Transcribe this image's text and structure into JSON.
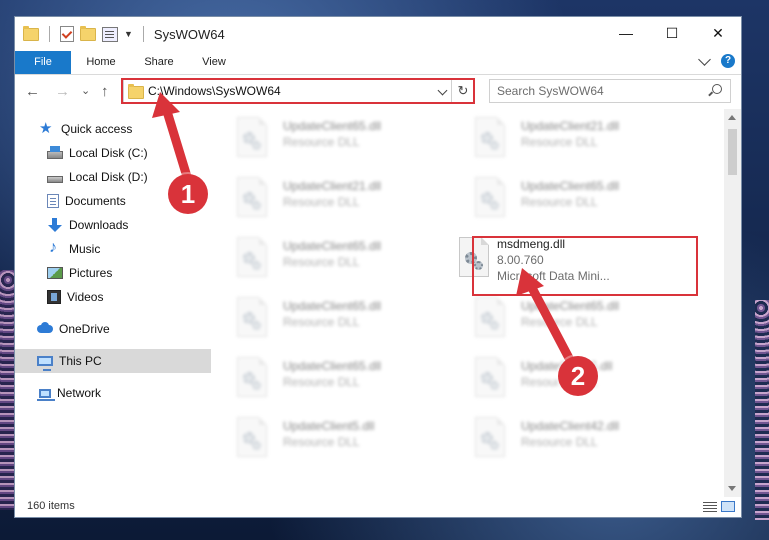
{
  "window": {
    "title": "SysWOW64",
    "controls": {
      "minimize": "—",
      "maximize": "☐",
      "close": "✕"
    }
  },
  "ribbon": {
    "tabs": [
      "File",
      "Home",
      "Share",
      "View"
    ]
  },
  "nav": {
    "back": "←",
    "forward": "→",
    "recent": "⌄",
    "up": "↑",
    "address": "C:\\Windows\\SysWOW64",
    "refresh": "↻",
    "search_placeholder": "Search SysWOW64"
  },
  "sidebar": {
    "items": [
      {
        "label": "Quick access",
        "icon": "quick-access-star-icon"
      },
      {
        "label": "Local Disk (C:)",
        "icon": "local-disk-icon",
        "pinned": true
      },
      {
        "label": "Local Disk (D:)",
        "icon": "local-disk-icon",
        "pinned": true
      },
      {
        "label": "Documents",
        "icon": "documents-icon",
        "pinned": true
      },
      {
        "label": "Downloads",
        "icon": "downloads-icon",
        "pinned": true
      },
      {
        "label": "Music",
        "icon": "music-icon",
        "pinned": true
      },
      {
        "label": "Pictures",
        "icon": "pictures-icon",
        "pinned": true
      },
      {
        "label": "Videos",
        "icon": "videos-icon",
        "pinned": true
      },
      {
        "label": "OneDrive",
        "icon": "onedrive-icon"
      },
      {
        "label": "This PC",
        "icon": "this-pc-icon",
        "selected": true
      },
      {
        "label": "Network",
        "icon": "network-icon"
      }
    ]
  },
  "files": [
    {
      "name": "UpdateClient65.dll",
      "desc": "Resource DLL"
    },
    {
      "name": "UpdateClient21.dll",
      "desc": "Resource DLL"
    },
    {
      "name": "UpdateClient21.dll",
      "desc": "Resource DLL"
    },
    {
      "name": "UpdateClient65.dll",
      "desc": "Resource DLL"
    },
    {
      "name": "UpdateClient65.dll",
      "desc": "Resource DLL"
    },
    {
      "name": "msdmeng.dll",
      "desc": "8.00.760",
      "desc2": "Microsoft Data Mini..."
    },
    {
      "name": "UpdateClient65.dll",
      "desc": "Resource DLL"
    },
    {
      "name": "UpdateClient65.dll",
      "desc": "Resource DLL"
    },
    {
      "name": "UpdateClient65.dll",
      "desc": "Resource DLL"
    },
    {
      "name": "UpdateClient5.dll",
      "desc": "Resource DLL"
    },
    {
      "name": "UpdateClient5.dll",
      "desc": "Resource DLL"
    },
    {
      "name": "UpdateClient42.dll",
      "desc": "Resource DLL"
    }
  ],
  "status": {
    "item_count": "160 items"
  },
  "annotations": {
    "step1": "1",
    "step2": "2"
  },
  "colors": {
    "accent": "#1979ca",
    "highlight": "#d9333a",
    "selected_bg": "#d9d9d9"
  }
}
